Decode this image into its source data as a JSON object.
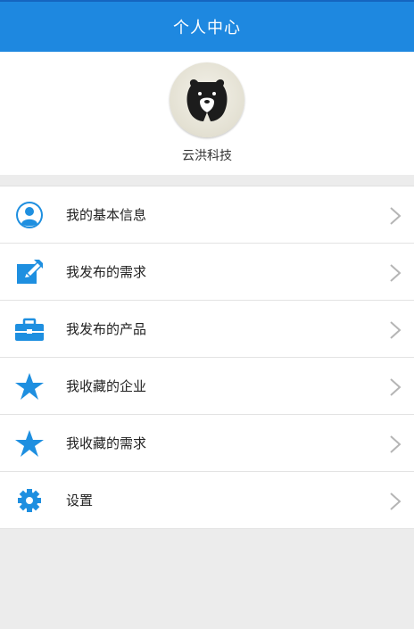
{
  "header": {
    "title": "个人中心"
  },
  "profile": {
    "name": "云洪科技"
  },
  "menu": {
    "items": [
      {
        "label": "我的基本信息",
        "icon": "user-icon"
      },
      {
        "label": "我发布的需求",
        "icon": "edit-icon"
      },
      {
        "label": "我发布的产品",
        "icon": "briefcase-icon"
      },
      {
        "label": "我收藏的企业",
        "icon": "star-icon"
      },
      {
        "label": "我收藏的需求",
        "icon": "star-icon"
      },
      {
        "label": "设置",
        "icon": "gear-icon"
      }
    ]
  },
  "colors": {
    "header_bg": "#1e88e0",
    "icon_blue": "#1e8fe0",
    "page_bg": "#ececec"
  }
}
